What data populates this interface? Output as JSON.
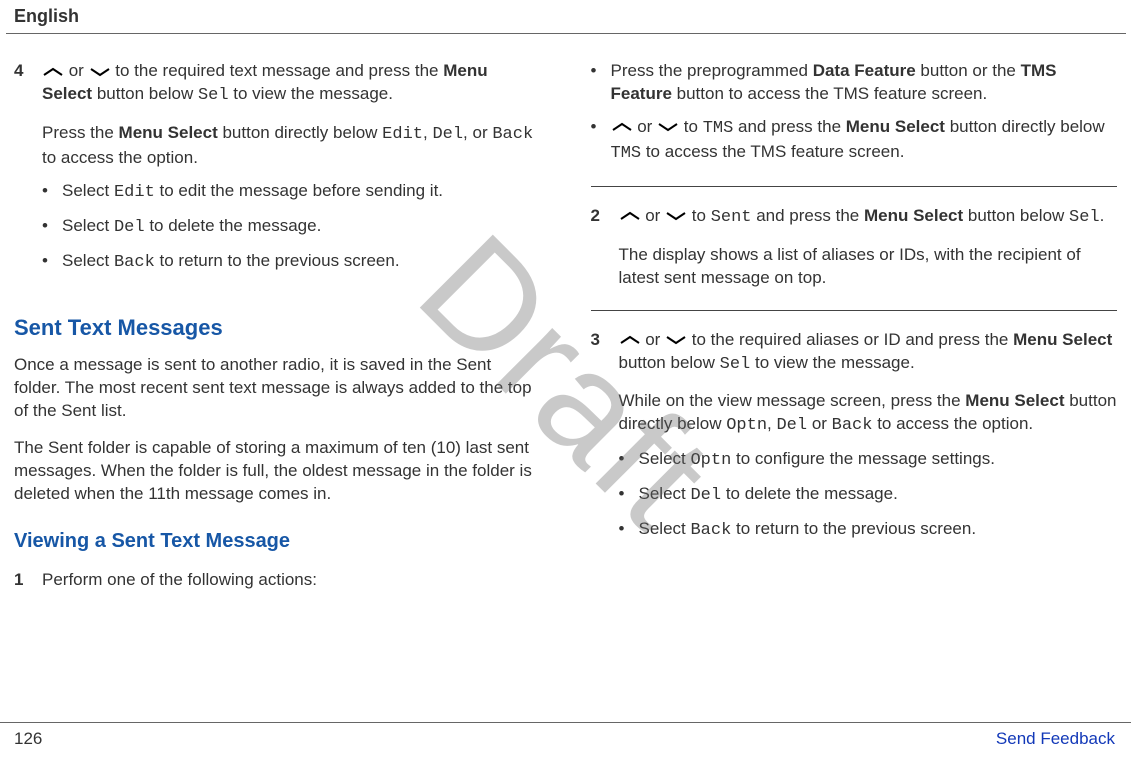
{
  "header": {
    "language": "English"
  },
  "watermark": "Draft",
  "left": {
    "step4": {
      "num": "4",
      "p1a": " or ",
      "p1b": " to the required text message and press the ",
      "p1c": "Menu Select",
      "p1d": " button below ",
      "p1e": "Sel",
      "p1f": " to view the message.",
      "p2a": "Press the ",
      "p2b": "Menu Select",
      "p2c": " button directly below ",
      "p2d": "Edit",
      "p2e": ", ",
      "p2f": "Del",
      "p2g": ", or ",
      "p2h": "Back",
      "p2i": " to access the option.",
      "b1a": "Select ",
      "b1b": "Edit",
      "b1c": " to edit the message before sending it.",
      "b2a": "Select ",
      "b2b": "Del",
      "b2c": " to delete the message.",
      "b3a": "Select ",
      "b3b": "Back",
      "b3c": " to return to the previous screen."
    },
    "h1": "Sent Text Messages",
    "para1": "Once a message is sent to another radio, it is saved in the Sent folder. The most recent sent text message is always added to the top of the Sent list.",
    "para2": "The Sent folder is capable of storing a maximum of ten (10) last sent messages. When the folder is full, the oldest message in the folder is deleted when the 11th message comes in.",
    "h2": "Viewing a Sent Text Message",
    "step1": {
      "num": "1",
      "text": "Perform one of the following actions:"
    }
  },
  "right": {
    "topBullets": {
      "b1a": "Press the preprogrammed ",
      "b1b": "Data Feature",
      "b1c": " button or the ",
      "b1d": "TMS Feature",
      "b1e": " button to access the TMS feature screen.",
      "b2a": " or ",
      "b2b": " to ",
      "b2c": "TMS",
      "b2d": " and press the ",
      "b2e": "Menu Select",
      "b2f": " button directly below ",
      "b2g": "TMS",
      "b2h": " to access the TMS feature screen."
    },
    "step2": {
      "num": "2",
      "p1a": " or ",
      "p1b": " to ",
      "p1c": "Sent",
      "p1d": " and press the ",
      "p1e": "Menu Select",
      "p1f": " button below ",
      "p1g": "Sel",
      "p1h": ".",
      "p2": "The display shows a list of aliases or IDs, with the recipient of latest sent message on top."
    },
    "step3": {
      "num": "3",
      "p1a": " or ",
      "p1b": " to the required aliases or ID and press the ",
      "p1c": "Menu Select",
      "p1d": " button below ",
      "p1e": "Sel",
      "p1f": " to view the message.",
      "p2a": "While on the view message screen, press the ",
      "p2b": "Menu Select",
      "p2c": " button directly below ",
      "p2d": "Optn",
      "p2e": ", ",
      "p2f": "Del",
      "p2g": " or ",
      "p2h": "Back",
      "p2i": " to access the option.",
      "b1a": "Select ",
      "b1b": "Optn",
      "b1c": " to configure the message settings.",
      "b2a": "Select ",
      "b2b": "Del",
      "b2c": " to delete the message.",
      "b3a": "Select ",
      "b3b": "Back",
      "b3c": " to return to the previous screen."
    }
  },
  "footer": {
    "page": "126",
    "feedback": "Send Feedback"
  }
}
